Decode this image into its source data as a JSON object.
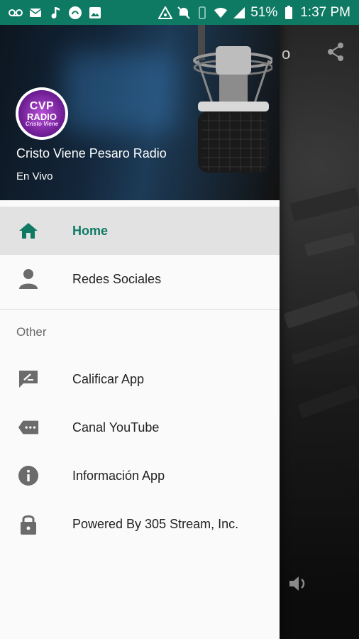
{
  "status_bar": {
    "battery": "51%",
    "time": "1:37 PM"
  },
  "header": {
    "logo_lines": [
      "CVP",
      "RADIO",
      "Cristo Viene"
    ],
    "station_name": "Cristo Viene Pesaro Radio",
    "subtitle": "En Vivo"
  },
  "menu": {
    "primary": [
      {
        "label": "Home",
        "icon": "home-icon",
        "active": true
      },
      {
        "label": "Redes Sociales",
        "icon": "person-icon",
        "active": false
      }
    ],
    "section_title": "Other",
    "secondary": [
      {
        "label": "Calificar App",
        "icon": "rate-review-icon"
      },
      {
        "label": "Canal YouTube",
        "icon": "video-label-icon"
      },
      {
        "label": "Información App",
        "icon": "info-icon"
      },
      {
        "label": "Powered By 305 Stream, Inc.",
        "icon": "lock-icon"
      }
    ]
  },
  "background_app": {
    "toolbar_glyph": "o"
  },
  "colors": {
    "accent": "#0f7a64",
    "status_bar": "#0f7a64",
    "active_row": "#e2e2e2",
    "icon_gray": "#6b6b6b"
  }
}
